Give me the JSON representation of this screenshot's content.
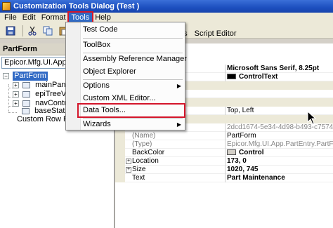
{
  "window": {
    "title": "Customization Tools Dialog  (Test )"
  },
  "menubar": {
    "items": [
      {
        "label": "File"
      },
      {
        "label": "Edit"
      },
      {
        "label": "Format"
      },
      {
        "label": "Tools"
      },
      {
        "label": "Help"
      }
    ]
  },
  "tabs": {
    "items": [
      {
        "label": "ds"
      },
      {
        "label": "Script Editor"
      }
    ]
  },
  "left_pane": {
    "header": "PartForm",
    "combo_value": "Epicor.Mfg.UI.App.Pa",
    "tree": [
      {
        "label": "PartForm"
      },
      {
        "label": "mainPane"
      },
      {
        "label": "epiTreeVie"
      },
      {
        "label": "navContro"
      },
      {
        "label": "baseStatu"
      },
      {
        "label": "Custom Row Rul"
      }
    ]
  },
  "tools_menu": {
    "items": [
      {
        "label": "Test Code"
      },
      {
        "label": "ToolBox"
      },
      {
        "label": "Assembly Reference Manager"
      },
      {
        "label": "Object Explorer"
      },
      {
        "label": "Options"
      },
      {
        "label": "Custom XML Editor..."
      },
      {
        "label": "Data Tools..."
      },
      {
        "label": "Wizards"
      }
    ]
  },
  "properties": {
    "font_value": "Microsoft Sans Serif, 8.25pt",
    "forecolor_value": "ControlText",
    "anchor_value": "Top, Left",
    "guid_value": "2dcd1674-5e34-4d98-b493-c7574",
    "rows": [
      {
        "name": "(Name)",
        "value": "PartForm"
      },
      {
        "name": "(Type)",
        "value": "Epicor.Mfg.UI.App.PartEntry.PartFor"
      },
      {
        "name": "BackColor",
        "value": "Control"
      },
      {
        "name": "Location",
        "value": "173, 0"
      },
      {
        "name": "Size",
        "value": "1020, 745"
      },
      {
        "name": "Text",
        "value": "Part Maintenance"
      }
    ]
  },
  "colors": {
    "highlight_outline": "#d4152a",
    "selection": "#316ac5",
    "titlebar": "#1c4fbf"
  }
}
